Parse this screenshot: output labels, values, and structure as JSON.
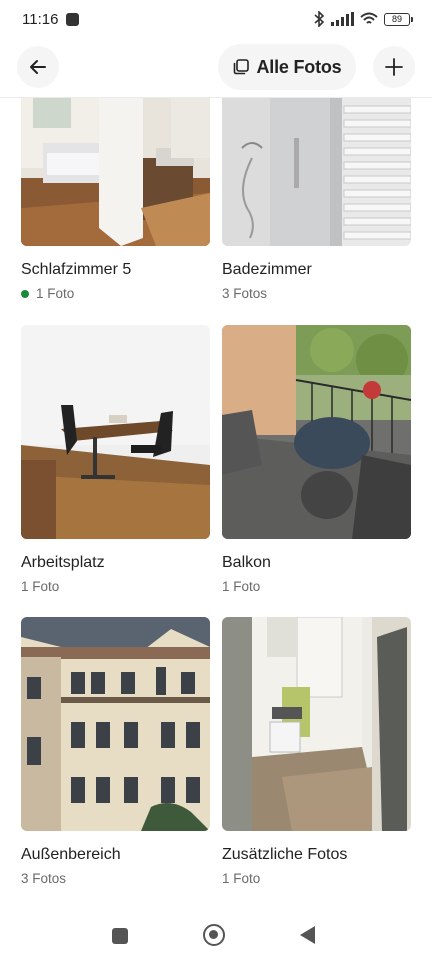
{
  "status_bar": {
    "time": "11:16",
    "battery": "89"
  },
  "header": {
    "back_icon": "arrow-left-icon",
    "all_photos_label": "Alle Fotos",
    "all_photos_icon": "photo-stack-icon",
    "add_icon": "plus-icon"
  },
  "rooms": [
    {
      "title": "Schlafzimmer 5",
      "count": "1 Foto",
      "status_dot": "#1a8a3a"
    },
    {
      "title": "Badezimmer",
      "count": "3 Fotos"
    },
    {
      "title": "Arbeitsplatz",
      "count": "1 Foto"
    },
    {
      "title": "Balkon",
      "count": "1 Foto"
    },
    {
      "title": "Außenbereich",
      "count": "3 Fotos"
    },
    {
      "title": "Zusätzliche Fotos",
      "count": "1 Foto"
    }
  ],
  "nav_bar": {
    "recents_icon": "square-icon",
    "home_icon": "circle-home-icon",
    "back_icon": "triangle-back-icon"
  }
}
